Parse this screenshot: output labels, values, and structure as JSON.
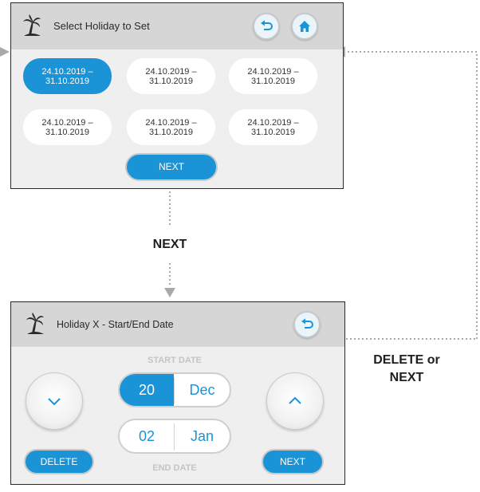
{
  "screen1": {
    "title": "Select Holiday to Set",
    "holidays": [
      {
        "line1": "24.10.2019 –",
        "line2": "31.10.2019",
        "selected": true
      },
      {
        "line1": "24.10.2019 –",
        "line2": "31.10.2019",
        "selected": false
      },
      {
        "line1": "24.10.2019 –",
        "line2": "31.10.2019",
        "selected": false
      },
      {
        "line1": "24.10.2019 –",
        "line2": "31.10.2019",
        "selected": false
      },
      {
        "line1": "24.10.2019 –",
        "line2": "31.10.2019",
        "selected": false
      },
      {
        "line1": "24.10.2019 –",
        "line2": "31.10.2019",
        "selected": false
      }
    ],
    "next_label": "NEXT",
    "icons": [
      "palm-tree-icon",
      "back-arrow-icon",
      "home-icon"
    ]
  },
  "screen2": {
    "title": "Holiday X - Start/End Date",
    "start_label": "START DATE",
    "end_label": "END DATE",
    "start_day": "20",
    "start_month": "Dec",
    "end_day": "02",
    "end_month": "Jan",
    "delete_label": "DELETE",
    "next_label": "NEXT",
    "icons": [
      "palm-tree-icon",
      "back-arrow-icon",
      "chevron-down-icon",
      "chevron-up-icon"
    ]
  },
  "flow": {
    "next_caption": "NEXT",
    "return_caption_line1": "DELETE or",
    "return_caption_line2": "NEXT"
  },
  "colors": {
    "accent": "#1a94d6",
    "screen_bg": "#efefef",
    "titlebar_bg": "#d6d6d6",
    "connector": "#a9a9a9"
  }
}
